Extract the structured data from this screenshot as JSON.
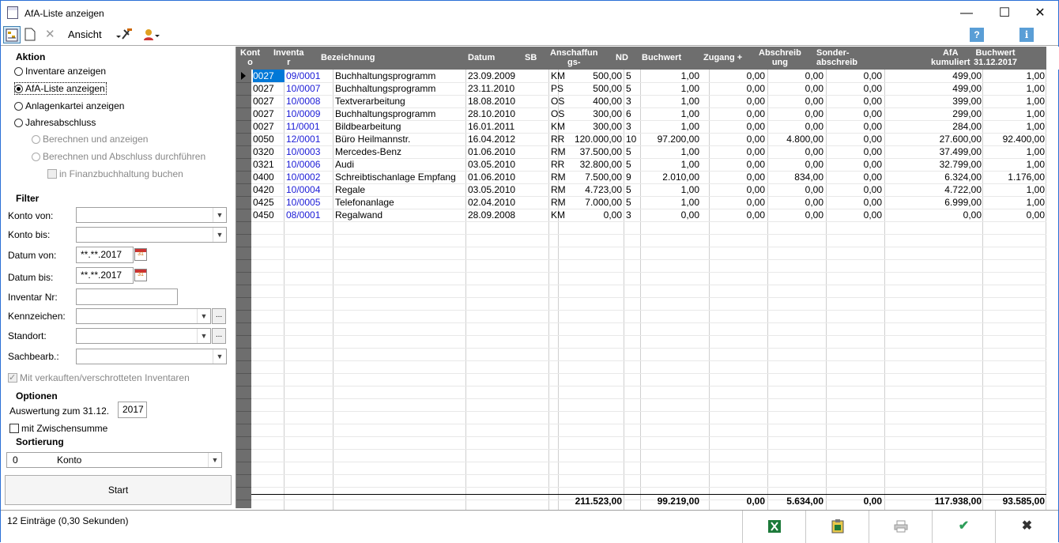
{
  "window": {
    "title": "AfA-Liste anzeigen",
    "min": "—",
    "max": "☐",
    "close": "✕"
  },
  "toolbar": {
    "view_label": "Ansicht"
  },
  "left": {
    "aktion_title": "Aktion",
    "radios": [
      "Inventare anzeigen",
      "AfA-Liste anzeigen",
      "Anlagenkartei anzeigen",
      "Jahresabschluss"
    ],
    "sub_radios": [
      "Berechnen und anzeigen",
      "Berechnen und Abschluss durchführen"
    ],
    "fibu_check": "in Finanzbuchhaltung buchen",
    "filter_title": "Filter",
    "konto_von": "Konto von:",
    "konto_bis": "Konto bis:",
    "datum_von": "Datum von:",
    "datum_von_val": "**.**.2017",
    "datum_bis": "Datum bis:",
    "datum_bis_val": "**.**.2017",
    "inventar_nr": "Inventar Nr:",
    "kennzeichen": "Kennzeichen:",
    "standort": "Standort:",
    "sachbearb": "Sachbearb.:",
    "verkauft_check": "Mit verkauften/verschrotteten Inventaren",
    "optionen_title": "Optionen",
    "auswertung": "Auswertung zum 31.12.",
    "auswertung_val": "2017",
    "zwischensumme": "mit Zwischensumme",
    "sortierung_title": "Sortierung",
    "sort_num": "0",
    "sort_val": "Konto",
    "start": "Start",
    "ellipsis": "..."
  },
  "grid": {
    "headers": [
      "Konto",
      "Inventar",
      "Bezeichnung",
      "Datum",
      "SB",
      "Anschaffungs-",
      "ND",
      "Buchwert",
      "Zugang +",
      "Abschreibung",
      "Sonder-abschreib",
      "AfA kumuliert",
      "Buchwert 31.12.2017"
    ],
    "header_l1": [
      "Kont",
      "Inventa",
      "Bezeichnung",
      "Datum",
      "SB",
      "Anschaffun",
      "ND",
      "Buchwert",
      "Zugang +",
      "Abschreib",
      "Sonder-",
      "AfA",
      "Buchwert"
    ],
    "header_l2": [
      "o",
      "r",
      "",
      "",
      "",
      "gs-",
      "",
      "",
      "",
      "ung",
      "abschreib",
      "kumuliert",
      "31.12.2017"
    ],
    "rows": [
      [
        "0027",
        "09/0001",
        "Buchhaltungsprogramm",
        "23.09.2009",
        "KM",
        "500,00",
        "5",
        "1,00",
        "0,00",
        "0,00",
        "0,00",
        "499,00",
        "1,00"
      ],
      [
        "0027",
        "10/0007",
        "Buchhaltungsprogramm",
        "23.11.2010",
        "PS",
        "500,00",
        "5",
        "1,00",
        "0,00",
        "0,00",
        "0,00",
        "499,00",
        "1,00"
      ],
      [
        "0027",
        "10/0008",
        "Textverarbeitung",
        "18.08.2010",
        "OS",
        "400,00",
        "3",
        "1,00",
        "0,00",
        "0,00",
        "0,00",
        "399,00",
        "1,00"
      ],
      [
        "0027",
        "10/0009",
        "Buchhaltungsprogramm",
        "28.10.2010",
        "OS",
        "300,00",
        "6",
        "1,00",
        "0,00",
        "0,00",
        "0,00",
        "299,00",
        "1,00"
      ],
      [
        "0027",
        "11/0001",
        "Bildbearbeitung",
        "16.01.2011",
        "KM",
        "300,00",
        "3",
        "1,00",
        "0,00",
        "0,00",
        "0,00",
        "284,00",
        "1,00"
      ],
      [
        "0050",
        "12/0001",
        "Büro Heilmannstr.",
        "16.04.2012",
        "RR",
        "120.000,00",
        "10",
        "97.200,00",
        "0,00",
        "4.800,00",
        "0,00",
        "27.600,00",
        "92.400,00"
      ],
      [
        "0320",
        "10/0003",
        "Mercedes-Benz",
        "01.06.2010",
        "RM",
        "37.500,00",
        "5",
        "1,00",
        "0,00",
        "0,00",
        "0,00",
        "37.499,00",
        "1,00"
      ],
      [
        "0321",
        "10/0006",
        "Audi",
        "03.05.2010",
        "RR",
        "32.800,00",
        "5",
        "1,00",
        "0,00",
        "0,00",
        "0,00",
        "32.799,00",
        "1,00"
      ],
      [
        "0400",
        "10/0002",
        "Schreibtischanlage Empfang",
        "01.06.2010",
        "RM",
        "7.500,00",
        "9",
        "2.010,00",
        "0,00",
        "834,00",
        "0,00",
        "6.324,00",
        "1.176,00"
      ],
      [
        "0420",
        "10/0004",
        "Regale",
        "03.05.2010",
        "RM",
        "4.723,00",
        "5",
        "1,00",
        "0,00",
        "0,00",
        "0,00",
        "4.722,00",
        "1,00"
      ],
      [
        "0425",
        "10/0005",
        "Telefonanlage",
        "02.04.2010",
        "RM",
        "7.000,00",
        "5",
        "1,00",
        "0,00",
        "0,00",
        "0,00",
        "6.999,00",
        "1,00"
      ],
      [
        "0450",
        "08/0001",
        "Regalwand",
        "28.09.2008",
        "KM",
        "0,00",
        "3",
        "0,00",
        "0,00",
        "0,00",
        "0,00",
        "0,00",
        "0,00"
      ]
    ],
    "totals": [
      "",
      "",
      "",
      "",
      "",
      "211.523,00",
      "",
      "99.219,00",
      "0,00",
      "5.634,00",
      "0,00",
      "117.938,00",
      "93.585,00"
    ]
  },
  "status": {
    "text": "12 Einträge (0,30 Sekunden)"
  },
  "colors": {
    "header_bg": "#6e6e6e",
    "link_blue": "#1a1ad6",
    "selection": "#0078d7"
  }
}
